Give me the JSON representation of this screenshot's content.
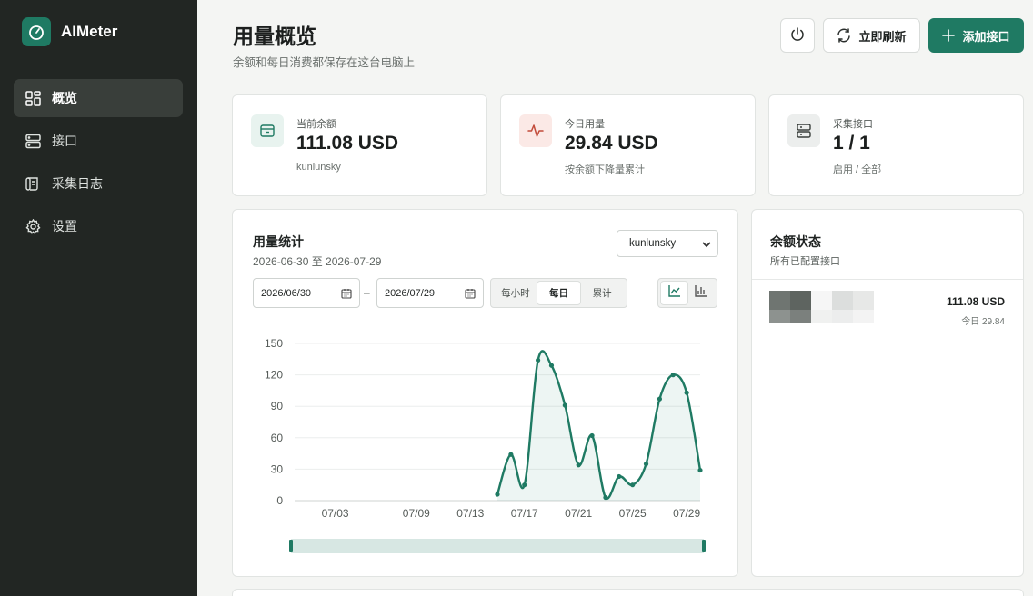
{
  "app": {
    "name": "AIMeter"
  },
  "sidebar": {
    "items": [
      {
        "label": "概览",
        "icon": "dashboard-icon",
        "active": true
      },
      {
        "label": "接口",
        "icon": "server-icon",
        "active": false
      },
      {
        "label": "采集日志",
        "icon": "log-icon",
        "active": false
      },
      {
        "label": "设置",
        "icon": "gear-icon",
        "active": false
      }
    ]
  },
  "header": {
    "title": "用量概览",
    "subtitle": "余额和每日消费都保存在这台电脑上",
    "refresh_label": "立即刷新",
    "add_label": "添加接口"
  },
  "stats": [
    {
      "label": "当前余额",
      "value": "111.08 USD",
      "sub": "kunlunsky",
      "icon": "wallet-icon"
    },
    {
      "label": "今日用量",
      "value": "29.84 USD",
      "sub": "按余额下降量累计",
      "icon": "activity-icon"
    },
    {
      "label": "采集接口",
      "value": "1 / 1",
      "sub": "启用 / 全部",
      "icon": "server-icon"
    }
  ],
  "usage": {
    "title": "用量统计",
    "range": "2026-06-30 至 2026-07-29",
    "selected_source": "kunlunsky",
    "start_date": "2026/06/30",
    "end_date": "2026/07/29",
    "date_separator": "–",
    "granularity": [
      "每小时",
      "每日",
      "累计"
    ],
    "granularity_active": 1
  },
  "chart_data": {
    "type": "area",
    "x": [
      "06/30",
      "07/01",
      "07/02",
      "07/03",
      "07/04",
      "07/05",
      "07/06",
      "07/07",
      "07/08",
      "07/09",
      "07/10",
      "07/11",
      "07/12",
      "07/13",
      "07/14",
      "07/15",
      "07/16",
      "07/17",
      "07/18",
      "07/19",
      "07/20",
      "07/21",
      "07/22",
      "07/23",
      "07/24",
      "07/25",
      "07/26",
      "07/27",
      "07/28",
      "07/29"
    ],
    "y": [
      null,
      null,
      null,
      null,
      null,
      null,
      null,
      null,
      null,
      null,
      null,
      null,
      null,
      null,
      null,
      6,
      44,
      15,
      134,
      129,
      91,
      34,
      62,
      3,
      23,
      15,
      35,
      97,
      120,
      103,
      29
    ],
    "xticks": [
      "07/03",
      "07/09",
      "07/13",
      "07/17",
      "07/21",
      "07/25",
      "07/29"
    ],
    "yticks": [
      0,
      30,
      60,
      90,
      120,
      150
    ],
    "ylim": [
      0,
      150
    ],
    "grid": true,
    "color": "#1f7a63"
  },
  "balance_panel": {
    "title": "余额状态",
    "subtitle": "所有已配置接口",
    "rows": [
      {
        "amount": "111.08 USD",
        "today": "今日 29.84"
      }
    ]
  },
  "colors": {
    "accent": "#1f7a63",
    "sidebar": "#222623",
    "danger_soft": "#fbe9e6"
  }
}
